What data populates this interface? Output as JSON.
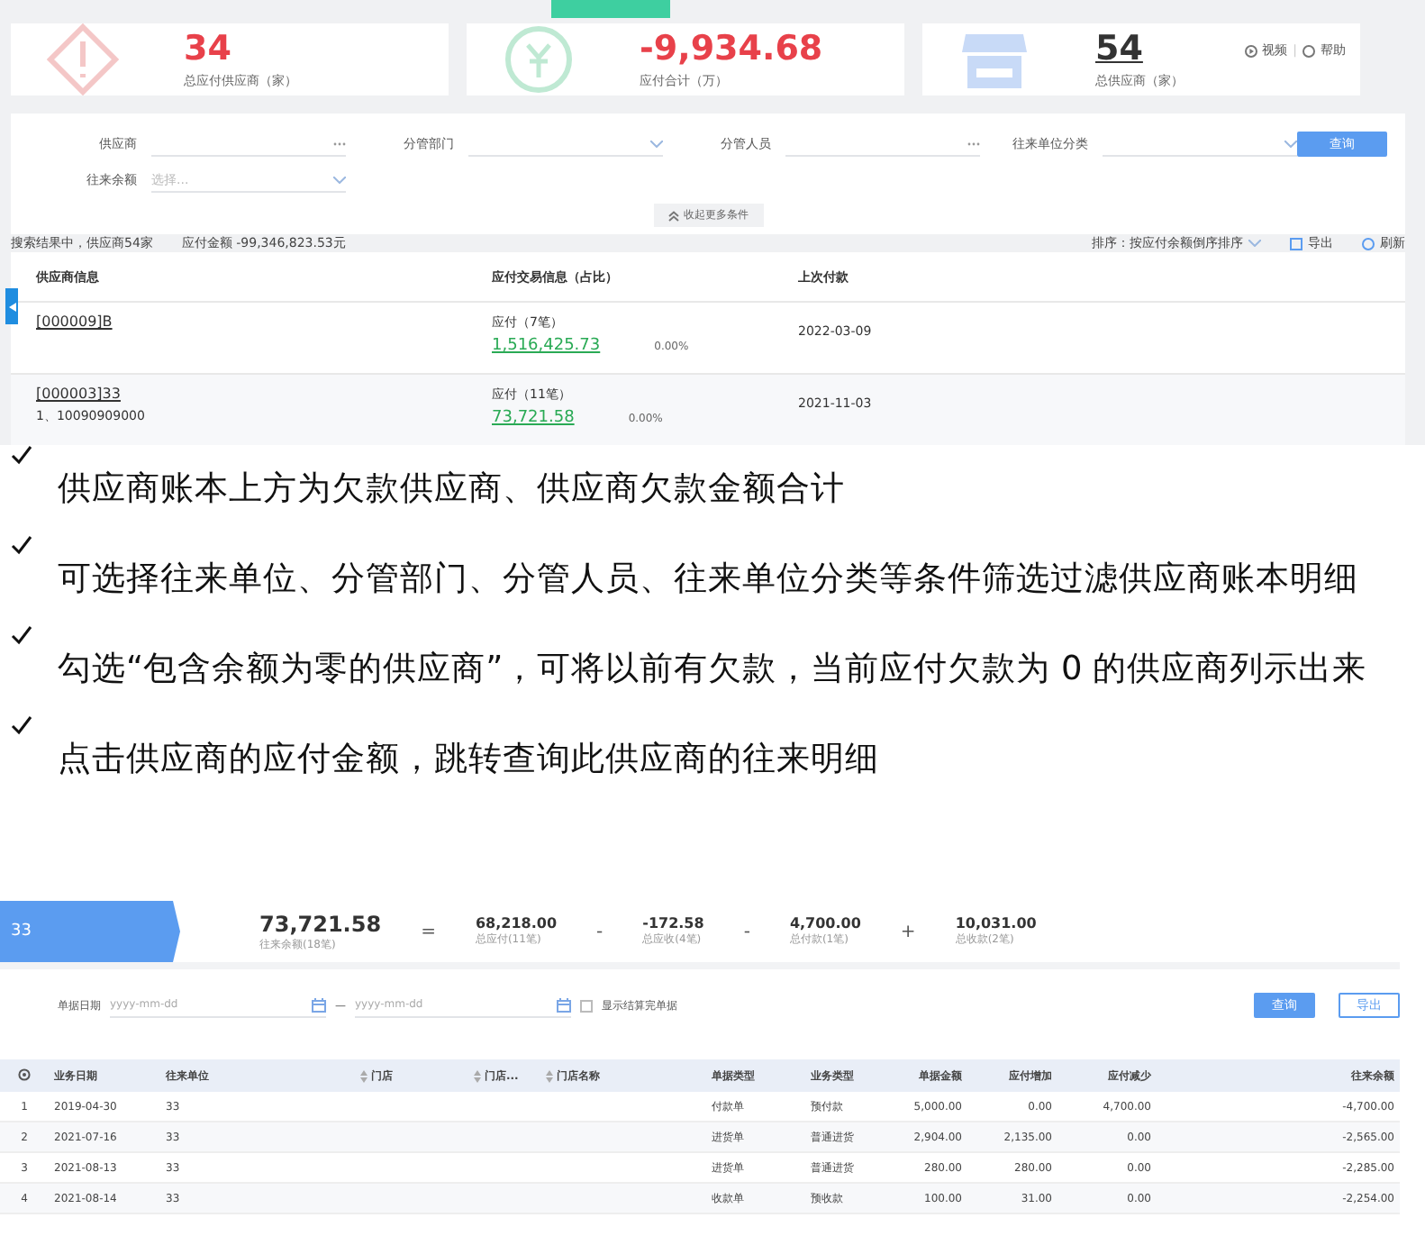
{
  "top_screen": {
    "stats": [
      {
        "kind": "alert",
        "value": "34",
        "label": "总应付供应商（家）",
        "underlined": false,
        "color": "#e8414a"
      },
      {
        "kind": "money",
        "value": "-9,934.68",
        "label": "应付合计（万）",
        "underlined": false,
        "color": "#e8414a"
      },
      {
        "kind": "shop",
        "value": "54",
        "label": "总供应商（家）",
        "underlined": true,
        "color": "#333333"
      }
    ],
    "help_links": [
      "视频",
      "帮助"
    ],
    "help_separator": "|",
    "filters": [
      {
        "label": "供应商",
        "kind": "lookup"
      },
      {
        "label": "分管部门",
        "kind": "select"
      },
      {
        "label": "分管人员",
        "kind": "lookup"
      },
      {
        "label": "往来单位分类",
        "kind": "select"
      },
      {
        "label": "往来余额",
        "kind": "select",
        "placeholder": "选择..."
      }
    ],
    "query_button": "查询",
    "collapse_button": "收起更多条件",
    "summary": [
      "搜索结果中，供应商54家",
      "应付金额 -99,346,823.53元"
    ],
    "sort": "排序：按应付余额倒序排序",
    "export": "导出",
    "refresh": "刷新",
    "table": {
      "columns": [
        "供应商信息",
        "应付交易信息（占比）",
        "上次付款"
      ],
      "rows": [
        {
          "supplier": "[000009]B",
          "trade": "应付（7笔）",
          "amount": "1,516,425.73",
          "ratio": "0.00%",
          "last": "2022-03-09"
        },
        {
          "supplier": "[000003]33",
          "sub": "1、10090909000",
          "trade": "应付（11笔）",
          "amount": "73,721.58",
          "ratio": "0.00%",
          "last": "2021-11-03"
        }
      ]
    }
  },
  "notes": [
    "供应商账本上方为欠款供应商、供应商欠款金额合计",
    "可选择往来单位、分管部门、分管人员、往来单位分类等条件筛选过滤供应商账本明细",
    "勾选“包含余额为零的供应商”，可将以前有欠款，当前应付欠款为 0 的供应商列示出来",
    "点击供应商的应付金额，跳转查询此供应商的往来明细"
  ],
  "bottom_screen": {
    "supplier": "33",
    "formula": [
      {
        "kind": "term",
        "value": "73,721.58",
        "label": "往来余额(18笔)"
      },
      {
        "kind": "op",
        "value": "="
      },
      {
        "kind": "term",
        "value": "68,218.00",
        "label": "总应付(11笔)"
      },
      {
        "kind": "op",
        "value": "-"
      },
      {
        "kind": "term",
        "value": "-172.58",
        "label": "总应收(4笔)"
      },
      {
        "kind": "op",
        "value": "-"
      },
      {
        "kind": "term",
        "value": "4,700.00",
        "label": "总付款(1笔)"
      },
      {
        "kind": "op",
        "value": "+"
      },
      {
        "kind": "term",
        "value": "10,031.00",
        "label": "总收款(2笔)"
      }
    ],
    "date_label": "单据日期",
    "date_from_placeholder": "yyyy-mm-dd",
    "date_separator": "—",
    "date_to_placeholder": "yyyy-mm-dd",
    "show_settled": {
      "label": "显示结算完单据",
      "checked": false
    },
    "buttons": [
      {
        "label": "查询",
        "primary": true
      },
      {
        "label": "导出",
        "primary": false
      }
    ],
    "table": {
      "columns": [
        {
          "label": "业务日期",
          "sortable": false
        },
        {
          "label": "往来单位",
          "sortable": false
        },
        {
          "label": "门店",
          "sortable": true
        },
        {
          "label": "门店...",
          "sortable": true
        },
        {
          "label": "门店名称",
          "sortable": true
        },
        {
          "label": "单据类型",
          "sortable": false
        },
        {
          "label": "业务类型",
          "sortable": false
        },
        {
          "label": "单据金额",
          "sortable": false
        },
        {
          "label": "应付增加",
          "sortable": false
        },
        {
          "label": "应付减少",
          "sortable": false
        },
        {
          "label": "往来余额",
          "sortable": false
        }
      ],
      "rows": [
        {
          "no": "1",
          "cells": [
            "2019-04-30",
            "33",
            "",
            "",
            "",
            "付款单",
            "预付款",
            "5,000.00",
            "0.00",
            "4,700.00",
            "-4,700.00"
          ]
        },
        {
          "no": "2",
          "cells": [
            "2021-07-16",
            "33",
            "",
            "",
            "",
            "进货单",
            "普通进货",
            "2,904.00",
            "2,135.00",
            "0.00",
            "-2,565.00"
          ]
        },
        {
          "no": "3",
          "cells": [
            "2021-08-13",
            "33",
            "",
            "",
            "",
            "进货单",
            "普通进货",
            "280.00",
            "280.00",
            "0.00",
            "-2,285.00"
          ]
        },
        {
          "no": "4",
          "cells": [
            "2021-08-14",
            "33",
            "",
            "",
            "",
            "收款单",
            "预收款",
            "100.00",
            "31.00",
            "0.00",
            "-2,254.00"
          ]
        }
      ]
    }
  }
}
